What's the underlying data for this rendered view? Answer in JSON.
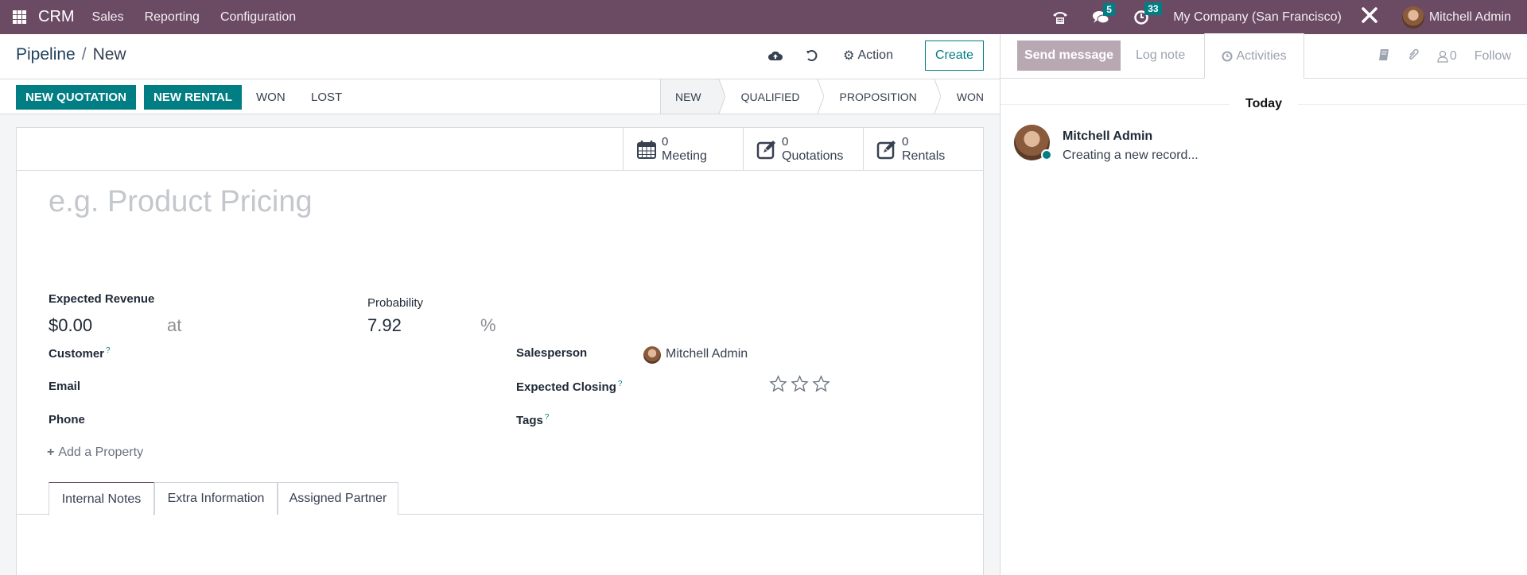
{
  "navbar": {
    "app_name": "CRM",
    "menus": [
      "Sales",
      "Reporting",
      "Configuration"
    ],
    "messages_badge": "5",
    "activities_badge": "33",
    "company": "My Company (San Francisco)",
    "user": "Mitchell Admin"
  },
  "control_panel": {
    "breadcrumb": [
      "Pipeline",
      "New"
    ],
    "breadcrumb_sep": "/",
    "action_label": "Action",
    "create_label": "Create"
  },
  "status_row": {
    "buttons": [
      "NEW QUOTATION",
      "NEW RENTAL"
    ],
    "links": [
      "WON",
      "LOST"
    ],
    "stages": [
      "NEW",
      "QUALIFIED",
      "PROPOSITION",
      "WON"
    ],
    "current_stage": "NEW"
  },
  "smart_buttons": [
    {
      "value": "0",
      "label": "Meeting",
      "icon": "calendar-icon"
    },
    {
      "value": "0",
      "label": "Quotations",
      "icon": "edit-icon"
    },
    {
      "value": "0",
      "label": "Rentals",
      "icon": "edit-icon"
    }
  ],
  "form": {
    "name_placeholder": "e.g. Product Pricing",
    "expected_revenue_label": "Expected Revenue",
    "expected_revenue_value": "$0.00",
    "at_label": "at",
    "probability_label": "Probability",
    "probability_value": "7.92",
    "percent_sign": "%",
    "customer_label": "Customer",
    "email_label": "Email",
    "phone_label": "Phone",
    "salesperson_label": "Salesperson",
    "salesperson_value": "Mitchell Admin",
    "expected_closing_label": "Expected Closing",
    "tags_label": "Tags",
    "help_mark": "?",
    "priority_stars": 0,
    "priority_max": 3,
    "add_property_label": "Add a Property",
    "tabs": [
      "Internal Notes",
      "Extra Information",
      "Assigned Partner"
    ],
    "active_tab": "Internal Notes"
  },
  "chatter": {
    "send_message_label": "Send message",
    "log_note_label": "Log note",
    "activities_label": "Activities",
    "followers_count": "0",
    "follow_label": "Follow",
    "date_separator": "Today",
    "messages": [
      {
        "author": "Mitchell Admin",
        "body": "Creating a new record..."
      }
    ]
  },
  "colors": {
    "brand": "#6b4b63",
    "primary": "#017e84"
  }
}
